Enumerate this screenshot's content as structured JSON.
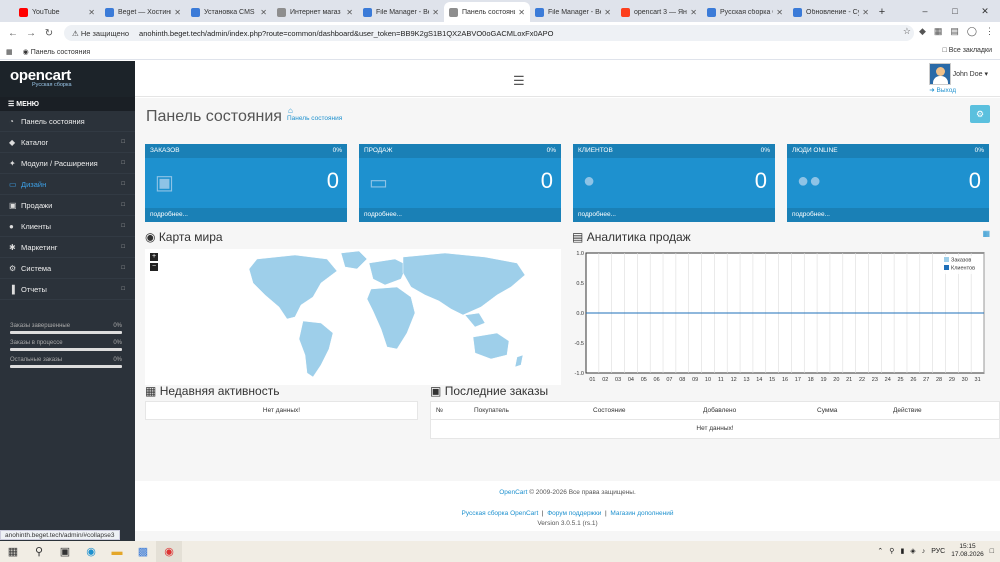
{
  "browser": {
    "tabs": [
      {
        "title": "YouTube",
        "color": "#ff0000",
        "active": false
      },
      {
        "title": "Beget — Хостинг",
        "color": "#3b7bd8",
        "active": false
      },
      {
        "title": "Установка CMS",
        "color": "#3b7bd8",
        "active": false
      },
      {
        "title": "Интернет магаз",
        "color": "#8e8e8e",
        "active": false
      },
      {
        "title": "File Manager - Be",
        "color": "#3b7bd8",
        "active": false
      },
      {
        "title": "Панель состояни",
        "color": "#8e8e8e",
        "active": true
      },
      {
        "title": "File Manager - Be",
        "color": "#3b7bd8",
        "active": false
      },
      {
        "title": "opencart 3 — Ян",
        "color": "#fc3f1d",
        "active": false
      },
      {
        "title": "Русская сборка С",
        "color": "#3b7bd8",
        "active": false
      },
      {
        "title": "Обновление - Су",
        "color": "#3b7bd8",
        "active": false
      }
    ],
    "security_label": "Не защищено",
    "url": "anohinth.beget.tech/admin/index.php?route=common/dashboard&user_token=BB9K2gS1B1QX2ABVO0oGACMLoxFx0APO",
    "bookmark": "Панель состояния",
    "all_bookmarks": "Все закладки",
    "status_url": "anohinth.beget.tech/admin/#collapse3"
  },
  "sidebar": {
    "logo": "opencart",
    "logo_sub": "Русская сборка",
    "menu_label": "МЕНЮ",
    "items": [
      {
        "label": "Панель состояния",
        "icon": "dashboard-icon",
        "glyph": "◔",
        "caret": false,
        "active": false
      },
      {
        "label": "Каталог",
        "icon": "tag-icon",
        "glyph": "◆",
        "caret": true,
        "active": false
      },
      {
        "label": "Модули / Расширения",
        "icon": "puzzle-icon",
        "glyph": "✦",
        "caret": true,
        "active": false
      },
      {
        "label": "Дизайн",
        "icon": "monitor-icon",
        "glyph": "▭",
        "caret": true,
        "active": true
      },
      {
        "label": "Продажи",
        "icon": "cart-icon",
        "glyph": "▣",
        "caret": true,
        "active": false
      },
      {
        "label": "Клиенты",
        "icon": "user-icon",
        "glyph": "●",
        "caret": true,
        "active": false
      },
      {
        "label": "Маркетинг",
        "icon": "share-icon",
        "glyph": "✱",
        "caret": true,
        "active": false
      },
      {
        "label": "Система",
        "icon": "gear-icon",
        "glyph": "⚙",
        "caret": true,
        "active": false
      },
      {
        "label": "Отчеты",
        "icon": "bar-chart-icon",
        "glyph": "▐",
        "caret": true,
        "active": false
      }
    ],
    "stats": [
      {
        "label": "Заказы завершенные",
        "value": "0%"
      },
      {
        "label": "Заказы в процессе",
        "value": "0%"
      },
      {
        "label": "Остальные заказы",
        "value": "0%"
      }
    ]
  },
  "header": {
    "user_name": "John Doe",
    "logout": "Выход"
  },
  "page": {
    "title": "Панель состояния",
    "breadcrumb": "Панель состояния"
  },
  "tiles": [
    {
      "label": "ЗАКАЗОВ",
      "percent": "0%",
      "value": "0",
      "more": "подробнее...",
      "icon": "cart-icon",
      "glyph": "▣"
    },
    {
      "label": "ПРОДАЖ",
      "percent": "0%",
      "value": "0",
      "more": "подробнее...",
      "icon": "credit-card-icon",
      "glyph": "▭"
    },
    {
      "label": "КЛИЕНТОВ",
      "percent": "0%",
      "value": "0",
      "more": "подробнее...",
      "icon": "user-icon",
      "glyph": "●"
    },
    {
      "label": "ЛЮДИ ONLINE",
      "percent": "0%",
      "value": "0",
      "more": "подробнее...",
      "icon": "users-icon",
      "glyph": "●●"
    }
  ],
  "map": {
    "title": "Карта мира",
    "zoom_in": "+",
    "zoom_out": "−",
    "color": "#9ecfea"
  },
  "chart_data": {
    "type": "line",
    "title": "Аналитика продаж",
    "x": [
      "01",
      "02",
      "03",
      "04",
      "05",
      "06",
      "07",
      "08",
      "09",
      "10",
      "11",
      "12",
      "13",
      "14",
      "15",
      "16",
      "17",
      "18",
      "19",
      "20",
      "21",
      "22",
      "23",
      "24",
      "25",
      "26",
      "27",
      "28",
      "29",
      "30",
      "31"
    ],
    "ylim": [
      -1.0,
      1.0
    ],
    "yticks": [
      "1.0",
      "0.5",
      "0.0",
      "-0.5",
      "-1.0"
    ],
    "series": [
      {
        "name": "Заказов",
        "color": "#9ecfea",
        "values": [
          0,
          0,
          0,
          0,
          0,
          0,
          0,
          0,
          0,
          0,
          0,
          0,
          0,
          0,
          0,
          0,
          0,
          0,
          0,
          0,
          0,
          0,
          0,
          0,
          0,
          0,
          0,
          0,
          0,
          0,
          0
        ]
      },
      {
        "name": "Клиентов",
        "color": "#1e6fb8",
        "values": [
          0,
          0,
          0,
          0,
          0,
          0,
          0,
          0,
          0,
          0,
          0,
          0,
          0,
          0,
          0,
          0,
          0,
          0,
          0,
          0,
          0,
          0,
          0,
          0,
          0,
          0,
          0,
          0,
          0,
          0,
          0
        ]
      }
    ],
    "grid": true,
    "legend": "top-right"
  },
  "activity": {
    "title": "Недавняя активность",
    "empty": "Нет данных!"
  },
  "orders": {
    "title": "Последние заказы",
    "columns": [
      "№",
      "Покупатель",
      "Состояние",
      "Добавлено",
      "Сумма",
      "Действие"
    ],
    "empty": "Нет данных!"
  },
  "footer": {
    "brand": "OpenCart",
    "copyright": "© 2009-2026 Все права защищены.",
    "links": [
      "Русская сборка OpenCart",
      "Форум поддержки",
      "Магазин дополнений"
    ],
    "separator": "|",
    "version": "Version 3.0.5.1 (rs.1)"
  },
  "taskbar": {
    "lang": "РУС",
    "time": "15:15",
    "date": "17.08.2026"
  },
  "colors": {
    "accent": "#1e91cf",
    "sidebar": "#2b323a"
  }
}
